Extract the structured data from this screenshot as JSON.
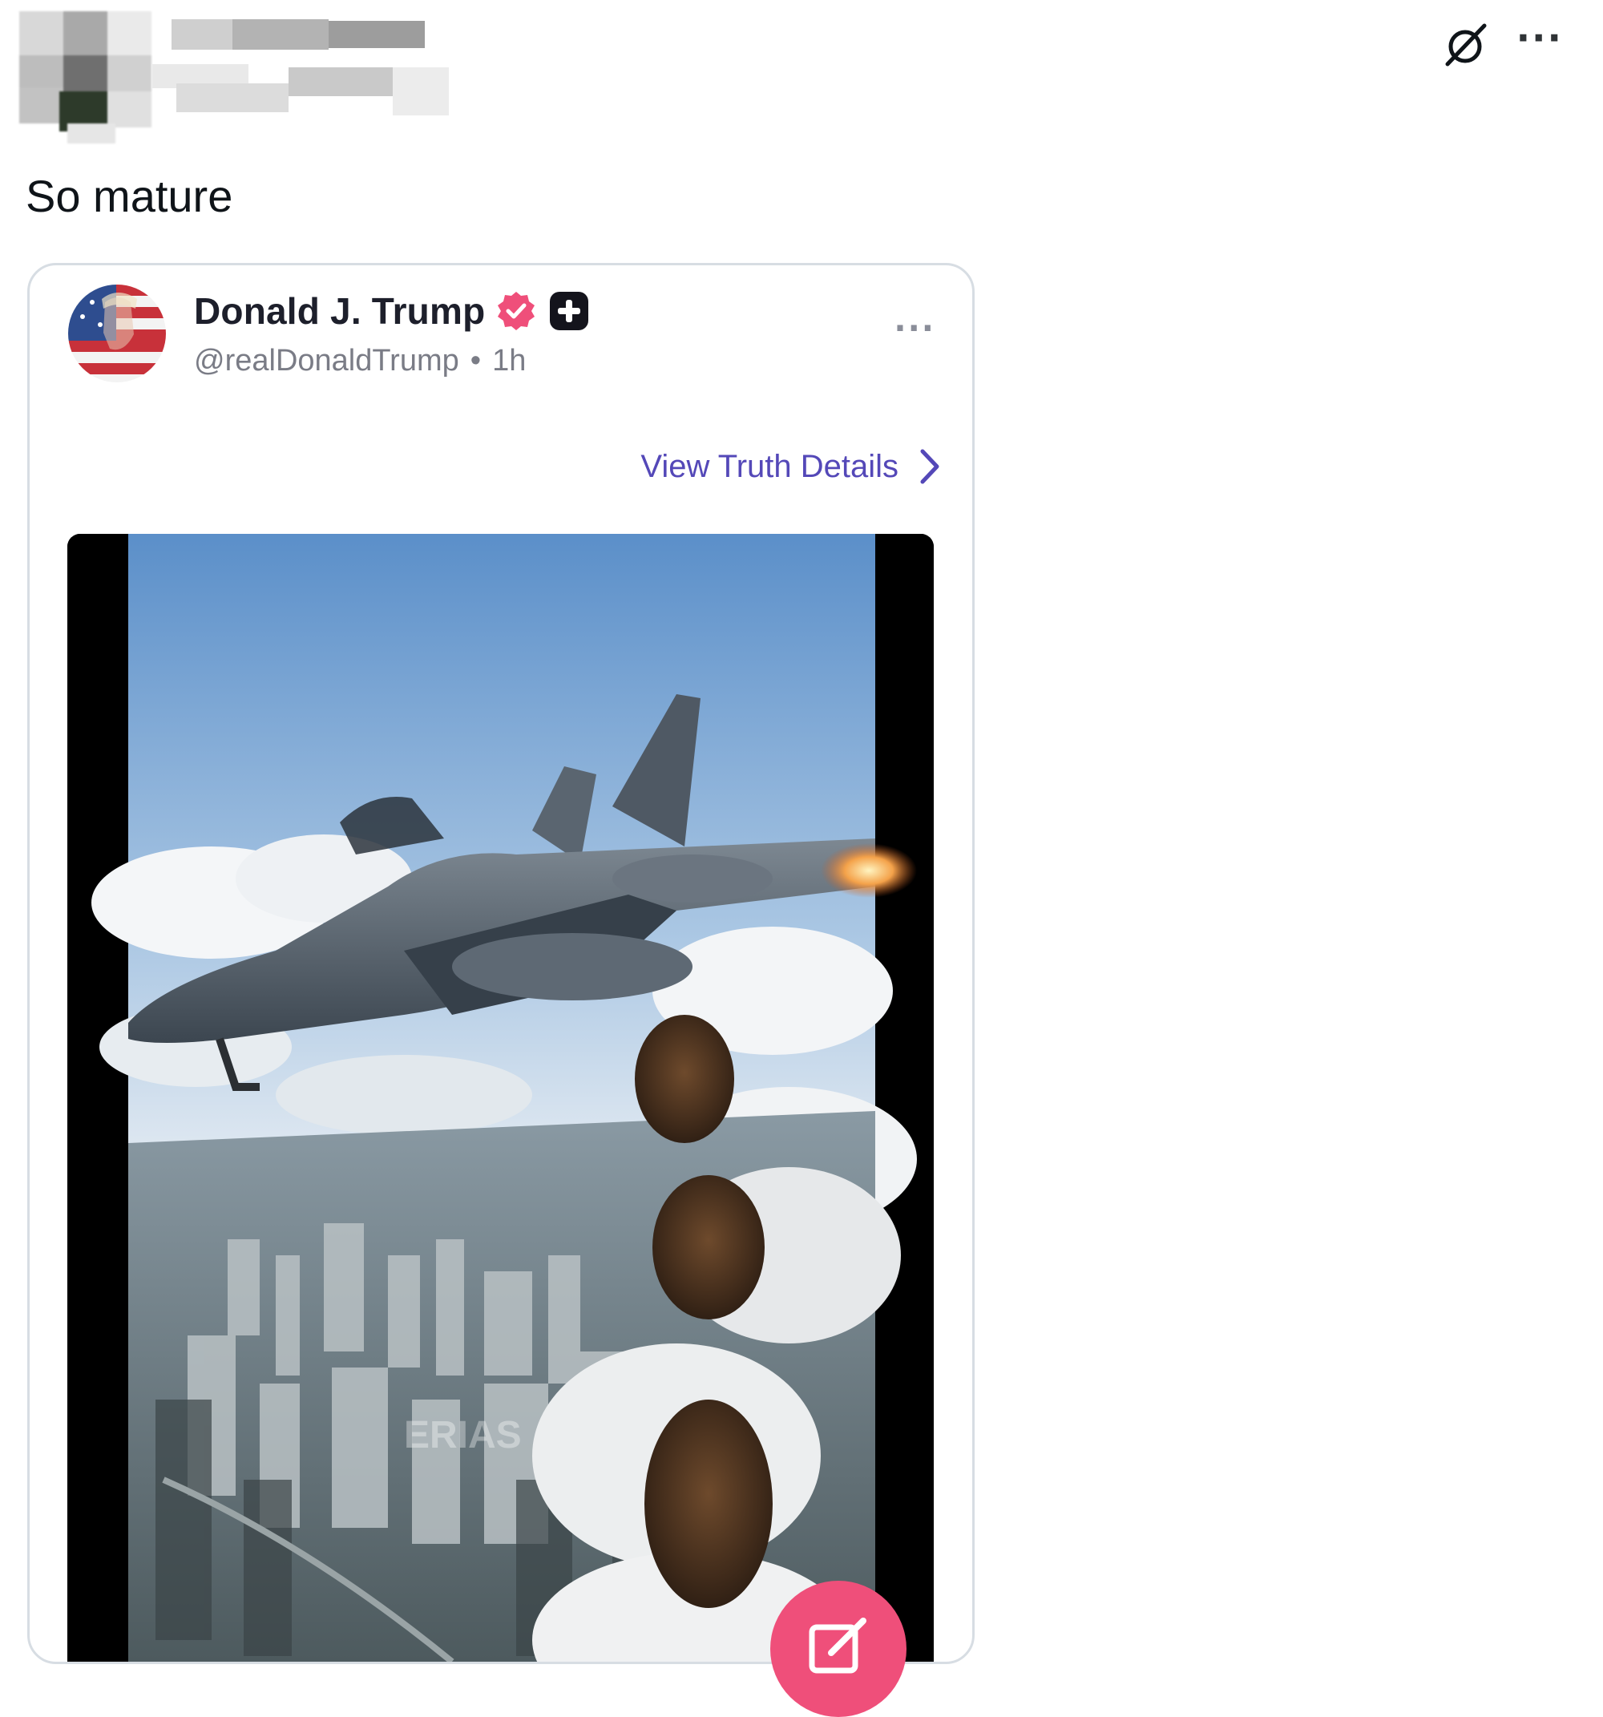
{
  "post": {
    "text": "So mature"
  },
  "embed": {
    "display_name": "Donald J. Trump",
    "handle": "@realDonaldTrump",
    "separator": "•",
    "time": "1h",
    "view_details_label": "View Truth Details",
    "media_watermark": "ERIAS"
  },
  "colors": {
    "link": "#5448b8",
    "verified_badge": "#ef4f7a",
    "fab": "#ef4f7a",
    "card_border": "#d7dde3"
  },
  "icons": {
    "grok": "slashed-circle-icon",
    "more": "more-horizontal-icon",
    "verified": "verified-badge-icon",
    "plus": "plus-badge-icon",
    "chevron": "chevron-right-icon",
    "compose": "compose-icon"
  }
}
